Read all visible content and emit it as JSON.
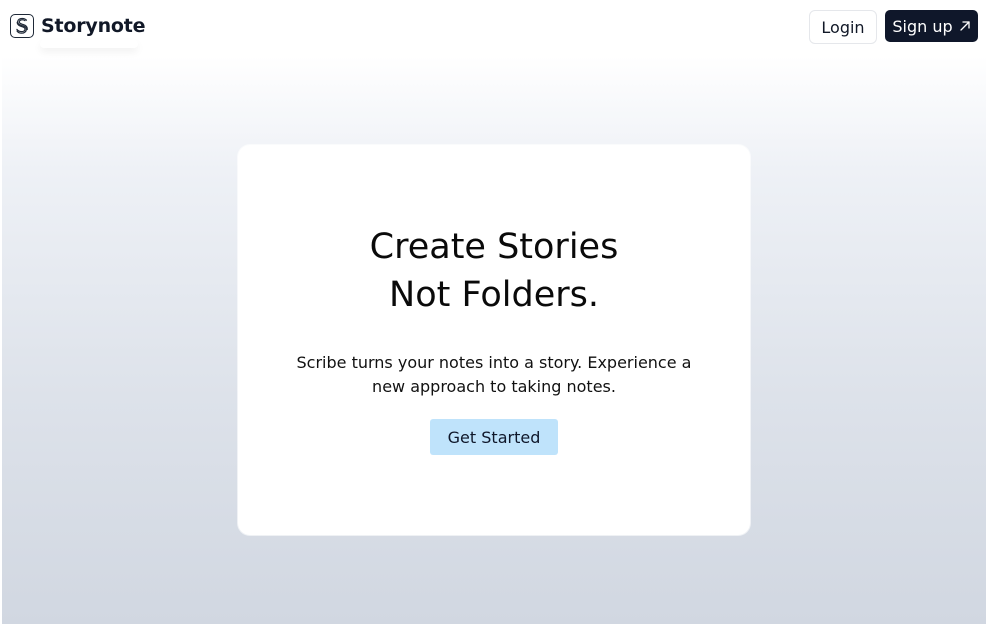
{
  "header": {
    "brand_name": "Storynote",
    "logo_icon": "storynote-s-logo-icon",
    "login_label": "Login",
    "signup_label": "Sign up",
    "signup_icon": "arrow-up-right-icon"
  },
  "hero": {
    "headline_line1": "Create Stories",
    "headline_line2": "Not Folders.",
    "subtext_line1": "Scribe turns your notes into a story. Experience a",
    "subtext_line2": "new approach to taking notes.",
    "cta_label": "Get Started"
  },
  "colors": {
    "signup_bg": "#0f172a",
    "cta_bg": "#bfe3fb",
    "gradient_top": "#ffffff",
    "gradient_bottom": "#d1d7e1"
  }
}
